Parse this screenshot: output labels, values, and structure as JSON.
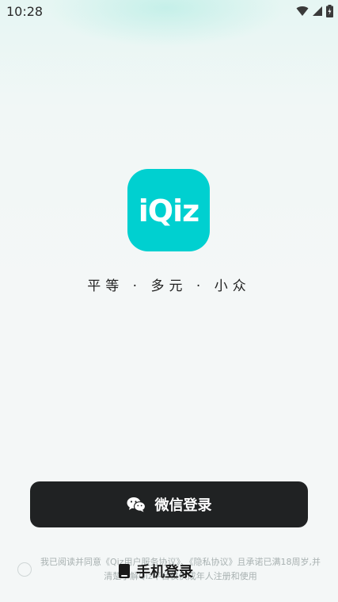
{
  "status_bar": {
    "time": "10:28",
    "icons": [
      "wifi-icon",
      "signal-icon",
      "battery-icon"
    ]
  },
  "logo": {
    "text": "iQiz",
    "color": "#00d0d0"
  },
  "slogan": "平等 · 多元 · 小众",
  "buttons": {
    "wechat_login": "微信登录",
    "phone_login": "手机登录"
  },
  "agreement": {
    "prefix": "我已阅读并同意",
    "user_agreement": "《Qiz用户服务协议》",
    "separator": "、",
    "privacy_policy": "《隐私协议》",
    "suffix": "且承诺已满18周岁,并清楚了解Qiz平台仅供成年人注册和使用",
    "checked": false
  },
  "colors": {
    "accent": "#00d0d0",
    "button_dark": "#202223",
    "background": "#f4f7f7"
  }
}
